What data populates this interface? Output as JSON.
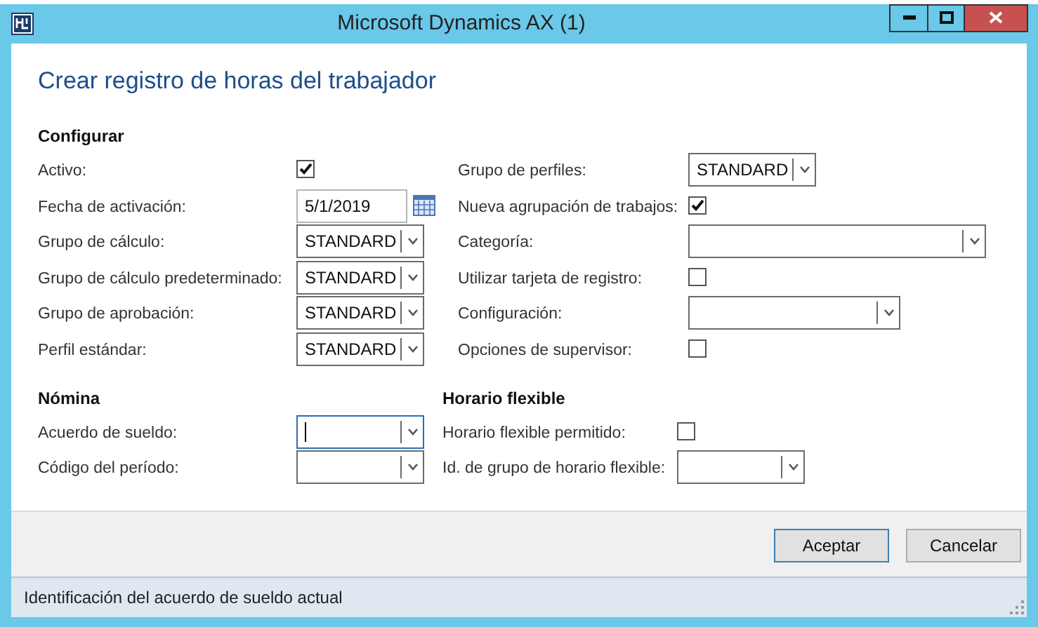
{
  "window": {
    "title": "Microsoft Dynamics AX (1)"
  },
  "form_title": "Crear registro de horas del trabajador",
  "configurar": {
    "heading": "Configurar",
    "left_fields": [
      {
        "label": "Activo:",
        "kind": "checkbox",
        "checked": true
      },
      {
        "label": "Fecha de activación:",
        "kind": "date",
        "value": "5/1/2019"
      },
      {
        "label": "Grupo de cálculo:",
        "kind": "combo",
        "value": "STANDARD",
        "focused": false
      },
      {
        "label": "Grupo de cálculo predeterminado:",
        "kind": "combo",
        "value": "STANDARD",
        "focused": false
      },
      {
        "label": "Grupo de aprobación:",
        "kind": "combo",
        "value": "STANDARD",
        "focused": false
      },
      {
        "label": "Perfil estándar:",
        "kind": "combo",
        "value": "STANDARD",
        "focused": false
      }
    ],
    "right_fields": [
      {
        "label": "Grupo de perfiles:",
        "kind": "combo",
        "value": "STANDARD",
        "focused": false
      },
      {
        "label": "Nueva agrupación de trabajos:",
        "kind": "checkbox",
        "checked": true
      },
      {
        "label": "Categoría:",
        "kind": "combo",
        "focused": false
      },
      {
        "label": "Utilizar tarjeta de registro:",
        "kind": "checkbox",
        "checked": false
      },
      {
        "label": "Configuración:",
        "kind": "combo",
        "focused": false
      },
      {
        "label": "Opciones de supervisor:",
        "kind": "checkbox",
        "checked": false
      }
    ]
  },
  "nomina": {
    "heading": "Nómina",
    "fields": [
      {
        "label": "Acuerdo de sueldo:",
        "kind": "combo",
        "focused": true
      },
      {
        "label": "Código del período:",
        "kind": "combo",
        "focused": false
      }
    ]
  },
  "horario_flexible": {
    "heading": "Horario flexible",
    "fields": [
      {
        "label": "Horario flexible permitido:",
        "kind": "checkbox",
        "checked": false
      },
      {
        "label": "Id. de grupo de horario flexible:",
        "kind": "combo",
        "focused": false
      }
    ]
  },
  "buttons": [
    {
      "label": "Aceptar",
      "default": true
    },
    {
      "label": "Cancelar",
      "default": false
    }
  ],
  "status_bar": "Identificación del acuerdo de sueldo actual"
}
